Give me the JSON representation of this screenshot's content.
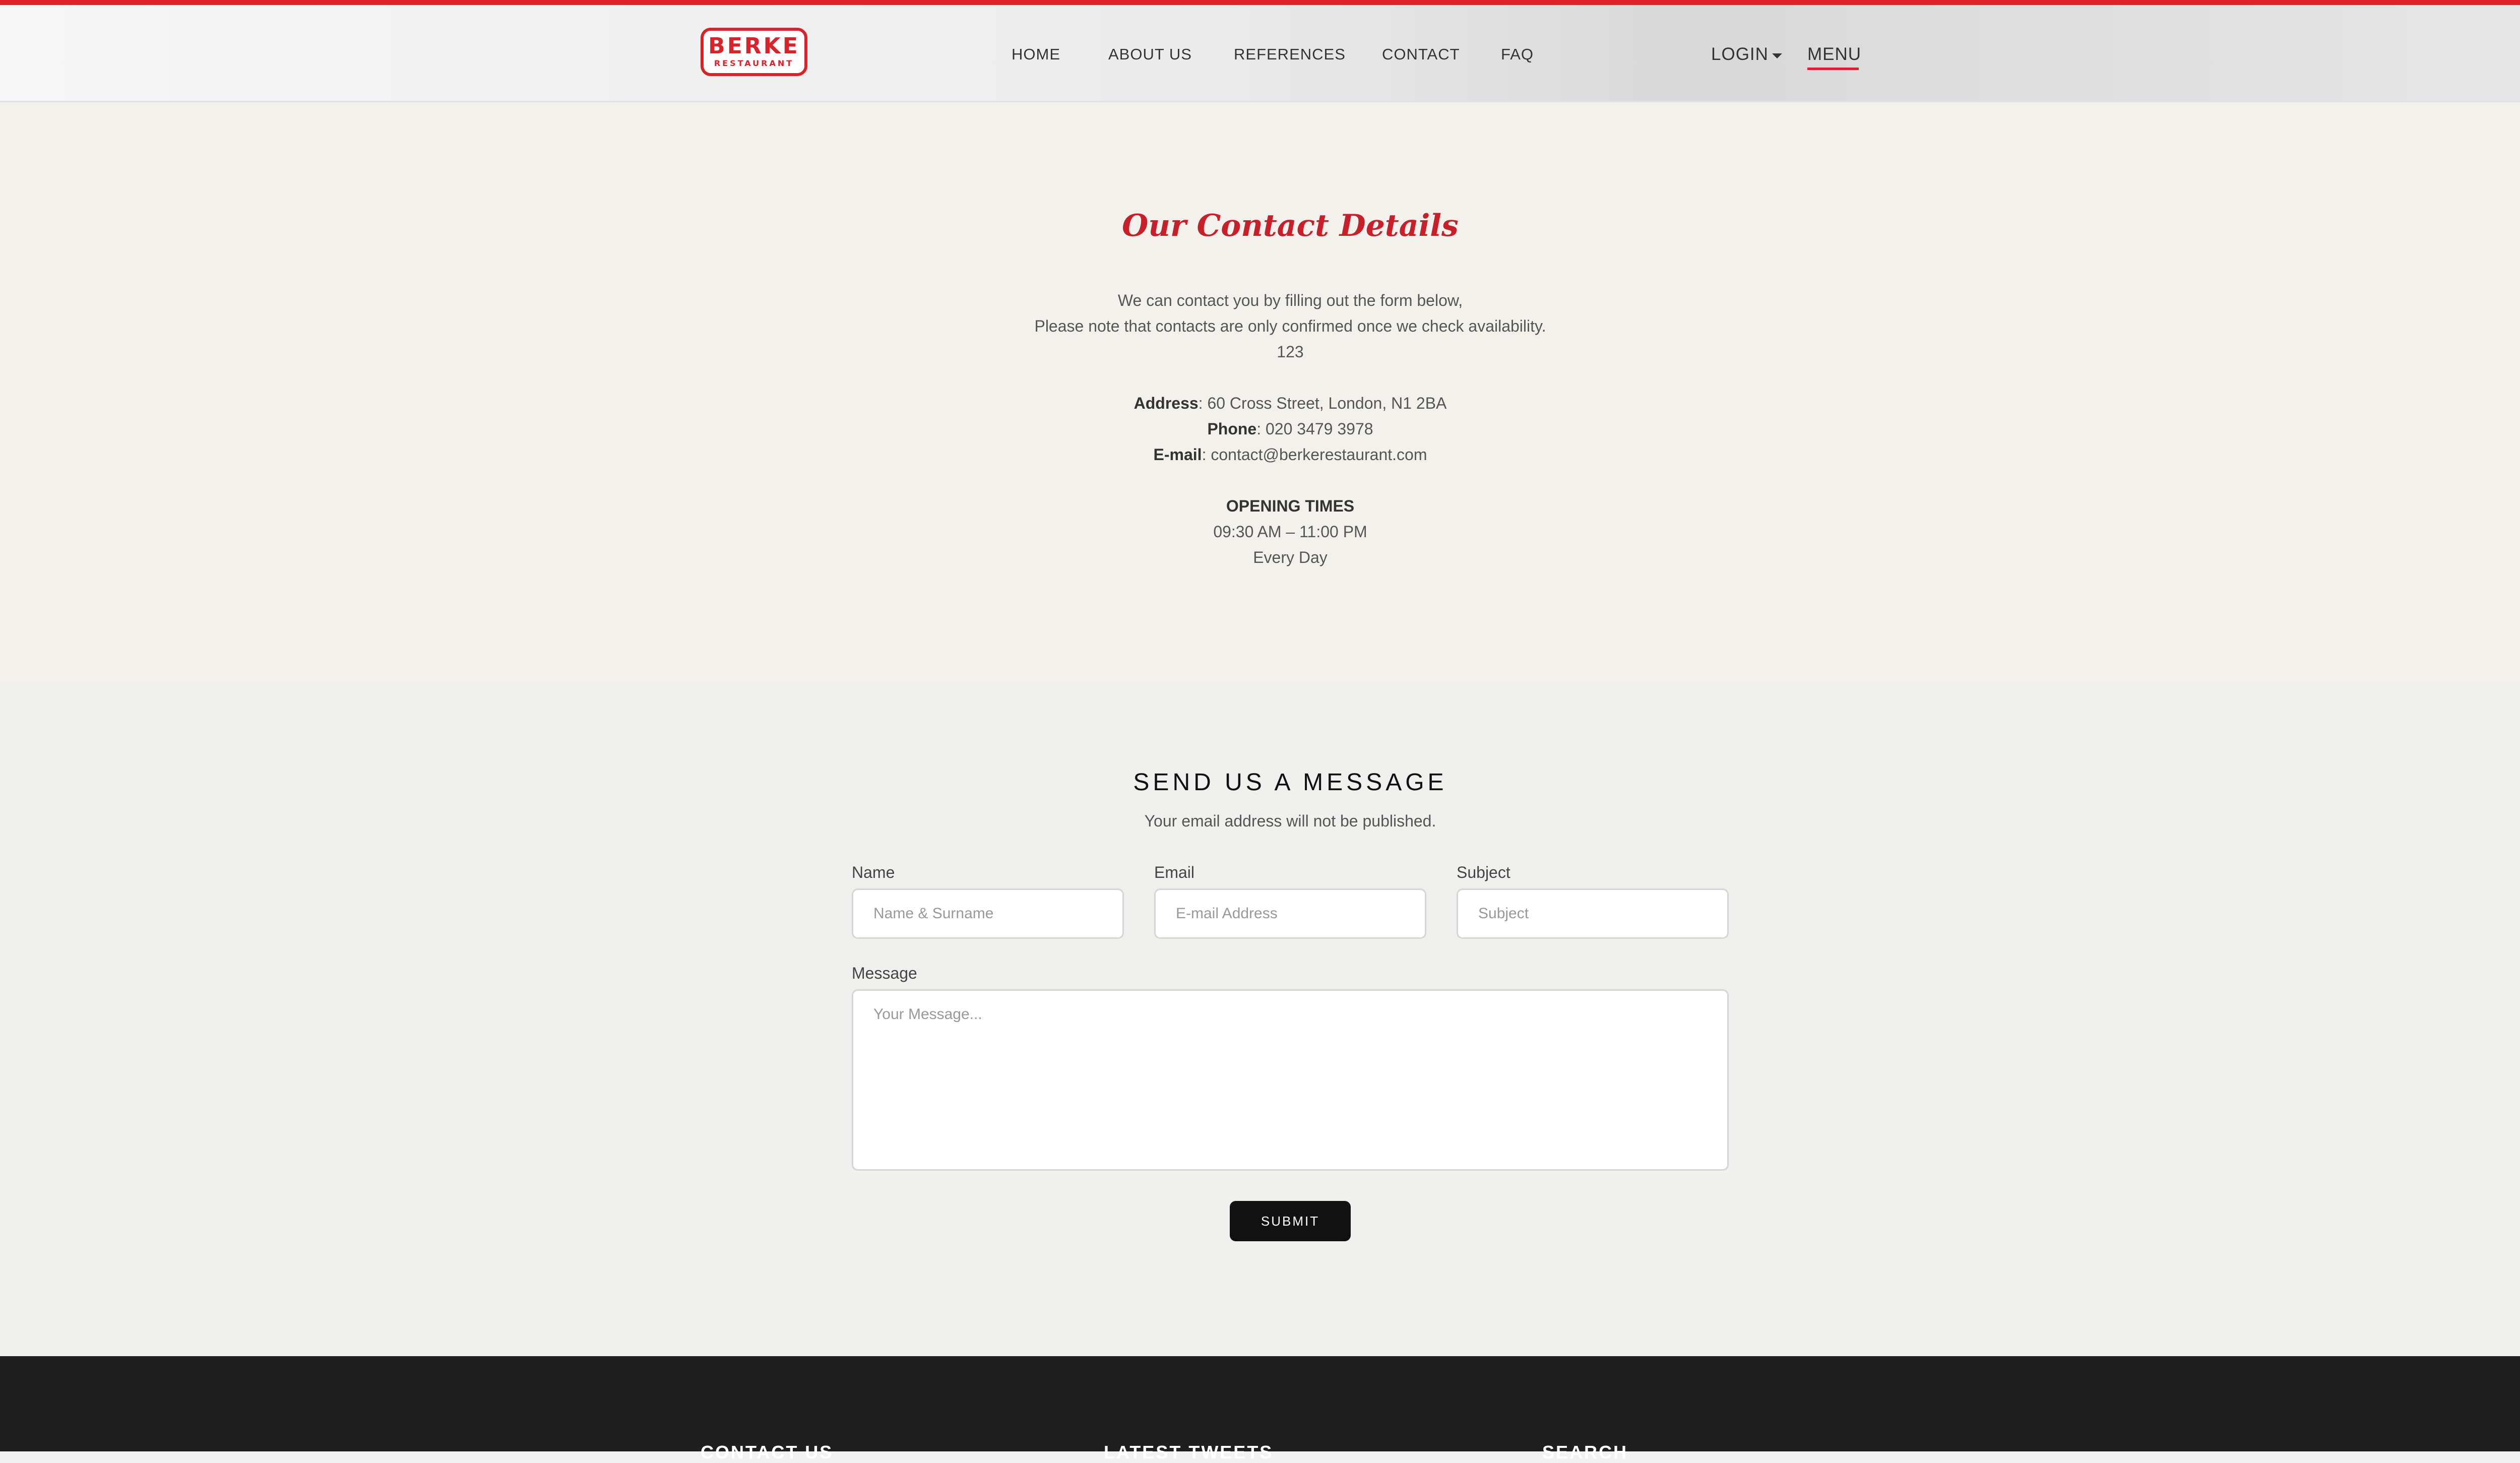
{
  "brand": {
    "name": "BERKE",
    "subtitle": "RESTAURANT",
    "accent": "#d8232a"
  },
  "nav": {
    "items": [
      "HOME",
      "ABOUT US",
      "REFERENCES",
      "CONTACT",
      "FAQ"
    ],
    "login": "LOGIN",
    "menu": "MENU"
  },
  "contact_details": {
    "title": "Our Contact Details",
    "intro_1": "We can contact you by filling out the form below,",
    "intro_2": "Please note that contacts are only confirmed once we check availability.",
    "intro_3": "123",
    "address_label": "Address",
    "address_value": ": 60 Cross Street, London, N1 2BA",
    "phone_label": "Phone",
    "phone_value": ": 020 3479 3978",
    "email_label": "E-mail",
    "email_value": ": contact@berkerestaurant.com",
    "opening_title": "OPENING TIMES",
    "opening_hours": "09:30 AM – 11:00 PM",
    "opening_days": "Every Day"
  },
  "message_form": {
    "title": "SEND US A MESSAGE",
    "subtitle": "Your email address will not be published.",
    "name_label": "Name",
    "name_placeholder": "Name & Surname",
    "email_label": "Email",
    "email_placeholder": "E-mail Address",
    "subject_label": "Subject",
    "subject_placeholder": "Subject",
    "message_label": "Message",
    "message_placeholder": "Your Message...",
    "submit_label": "SUBMIT"
  },
  "footer": {
    "columns": [
      "CONTACT US",
      "LATEST TWEETS",
      "SEARCH"
    ]
  }
}
